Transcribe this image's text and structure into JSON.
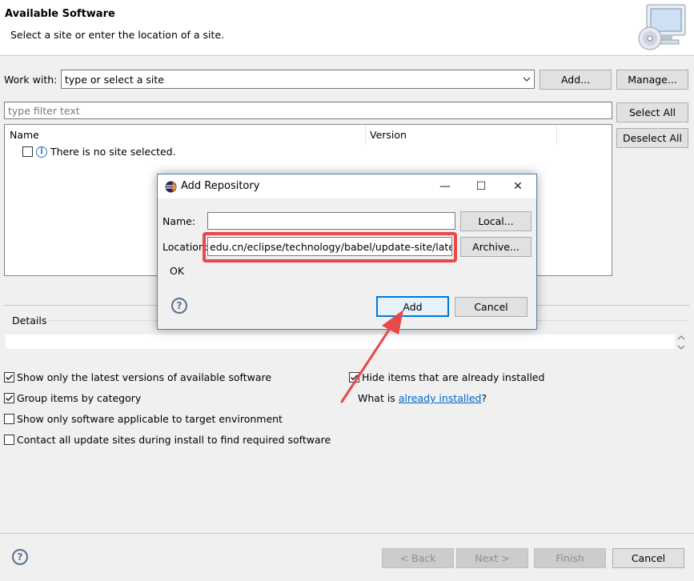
{
  "banner": {
    "title": "Available Software",
    "subtitle": "Select a site or enter the location of a site."
  },
  "work_with": {
    "label": "Work with:",
    "placeholder": "type or select a site",
    "add_label": "Add...",
    "manage_label": "Manage..."
  },
  "filter": {
    "placeholder": "type filter text",
    "select_all_label": "Select All",
    "deselect_all_label": "Deselect All"
  },
  "tree": {
    "columns": [
      "Name",
      "Version"
    ],
    "empty_message": "There is no site selected."
  },
  "details": {
    "label": "Details"
  },
  "options": {
    "latest_versions": {
      "label": "Show only the latest versions of available software",
      "checked": true
    },
    "group_by_category": {
      "label": "Group items by category",
      "checked": true
    },
    "target_env": {
      "label": "Show only software applicable to target environment",
      "checked": false
    },
    "contact_sites": {
      "label": "Contact all update sites during install to find required software",
      "checked": false
    },
    "hide_installed": {
      "label": "Hide items that are already installed",
      "checked": true
    },
    "what_is_prefix": "What is ",
    "what_is_link": "already installed",
    "what_is_suffix": "?"
  },
  "footer": {
    "back_label": "< Back",
    "next_label": "Next >",
    "finish_label": "Finish",
    "cancel_label": "Cancel"
  },
  "dialog": {
    "title": "Add Repository",
    "name_label": "Name:",
    "name_value": "",
    "local_label": "Local...",
    "location_label": "Location:",
    "location_value": "edu.cn/eclipse/technology/babel/update-site/latest/",
    "archive_label": "Archive...",
    "status": "OK",
    "add_label": "Add",
    "cancel_label": "Cancel",
    "minimize_symbol": "—",
    "maximize_symbol": "☐",
    "close_symbol": "✕"
  },
  "colors": {
    "highlight": "#e8494b",
    "arrow": "#e8494b",
    "link": "#0066cc",
    "default_button_border": "#0078d7"
  }
}
